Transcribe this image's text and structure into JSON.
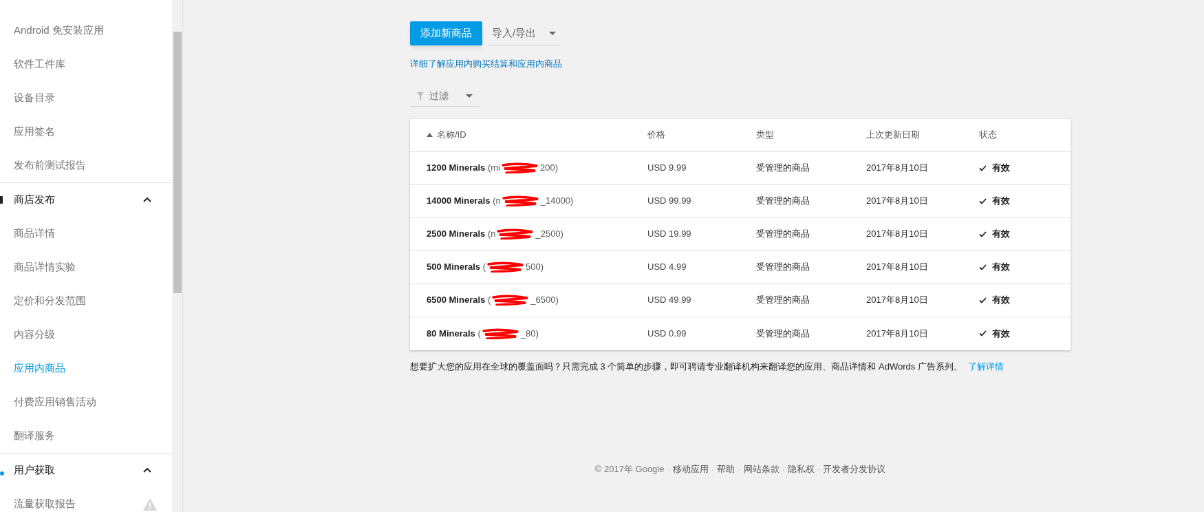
{
  "sidebar": {
    "groups": [
      {
        "items": [
          {
            "label": "Android 免安装应用",
            "selected": false,
            "warning": false
          },
          {
            "label": "软件工件库",
            "selected": false,
            "warning": false
          },
          {
            "label": "设备目录",
            "selected": false,
            "warning": false
          },
          {
            "label": "应用签名",
            "selected": false,
            "warning": false
          },
          {
            "label": "发布前测试报告",
            "selected": false,
            "warning": false
          }
        ]
      },
      {
        "title": "商店发布",
        "expanded": true,
        "items": [
          {
            "label": "商品详情",
            "selected": false,
            "warning": false
          },
          {
            "label": "商品详情实验",
            "selected": false,
            "warning": false
          },
          {
            "label": "定价和分发范围",
            "selected": false,
            "warning": false
          },
          {
            "label": "内容分级",
            "selected": false,
            "warning": false
          },
          {
            "label": "应用内商品",
            "selected": true,
            "warning": false
          },
          {
            "label": "付费应用销售活动",
            "selected": false,
            "warning": false
          },
          {
            "label": "翻译服务",
            "selected": false,
            "warning": false
          }
        ]
      },
      {
        "title": "用户获取",
        "expanded": true,
        "items": [
          {
            "label": "流量获取报告",
            "selected": false,
            "warning": true
          }
        ]
      }
    ]
  },
  "toolbar": {
    "add_button": "添加新商品",
    "import_export": "导入/导出",
    "learn_link": "详细了解应用内购买结算和应用内商品",
    "filter": "过滤"
  },
  "table": {
    "columns": [
      "名称/ID",
      "价格",
      "类型",
      "上次更新日期",
      "状态"
    ],
    "rows": [
      {
        "name_and_id": "**1200 Minerals** (mi",
        "id_end": "200)",
        "price": "USD 9.99",
        "type": "受管理的商品",
        "date": "2017年8月10日",
        "status": "有效",
        "active": true
      },
      {
        "name_and_id": "**14000 Minerals** (n",
        "id_end": "_14000)",
        "price": "USD 99.99",
        "type": "受管理的商品",
        "date": "2017年8月10日",
        "status": "有效",
        "active": true
      },
      {
        "name_and_id": "**2500 Minerals** (n",
        "id_end": "_2500)",
        "price": "USD 19.99",
        "type": "受管理的商品",
        "date": "2017年8月10日",
        "status": "有效",
        "active": true
      },
      {
        "name_and_id": "**500 Minerals** (",
        "id_end": "500)",
        "price": "USD 4.99",
        "type": "受管理的商品",
        "date": "2017年8月10日",
        "status": "有效",
        "active": true
      },
      {
        "name_and_id": "**6500 Minerals** (",
        "id_end": "_6500)",
        "price": "USD 49.99",
        "type": "受管理的商品",
        "date": "2017年8月10日",
        "status": "有效",
        "active": true
      },
      {
        "name_and_id": "**80 Minerals** (",
        "id_end": "_80)",
        "price": "USD 0.99",
        "type": "受管理的商品",
        "date": "2017年8月10日",
        "status": "有效",
        "active": true
      }
    ]
  },
  "promo": {
    "text": "想要扩大您的应用在全球的覆盖面吗？只需完成 3 个简单的步骤，即可聘请专业翻译机构来翻译您的应用、商品详情和 AdWords 广告系列。",
    "link": "了解详情"
  },
  "footer": {
    "separator": "·",
    "items": [
      "© 2017年 Google",
      "移动应用",
      "帮助",
      "网站条款",
      "隐私权",
      "开发者分发协议"
    ]
  }
}
